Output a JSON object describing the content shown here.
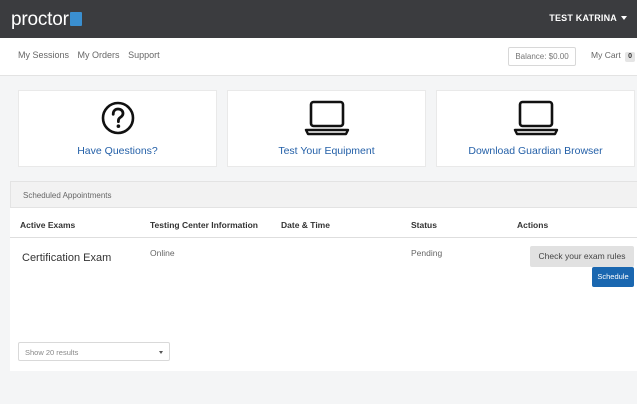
{
  "header": {
    "logo_text": "proctor",
    "user_name": "TEST KATRINA"
  },
  "nav": {
    "links": [
      "My Sessions",
      "My Orders",
      "Support"
    ],
    "balance": "Balance: $0.00",
    "cart_label": "My Cart",
    "cart_count": "0"
  },
  "cards": [
    {
      "label": "Have Questions?",
      "icon": "question-circle-icon"
    },
    {
      "label": "Test Your Equipment",
      "icon": "laptop-icon"
    },
    {
      "label": "Download Guardian Browser",
      "icon": "laptop-icon"
    }
  ],
  "appointments": {
    "title": "Scheduled Appointments",
    "columns": [
      "Active Exams",
      "Testing Center Information",
      "Date & Time",
      "Status",
      "Actions"
    ],
    "rows": [
      {
        "exam": "Certification Exam",
        "center": "Online",
        "datetime": "",
        "status": "Pending",
        "actions": [
          "Check your exam rules",
          "Schedule"
        ]
      }
    ],
    "page_size_selected": "Show 20 results"
  },
  "colors": {
    "topbar": "#3b3c3f",
    "link_blue": "#2460a8",
    "primary_button": "#1a67b0",
    "logo_accent": "#3a8fd0"
  }
}
